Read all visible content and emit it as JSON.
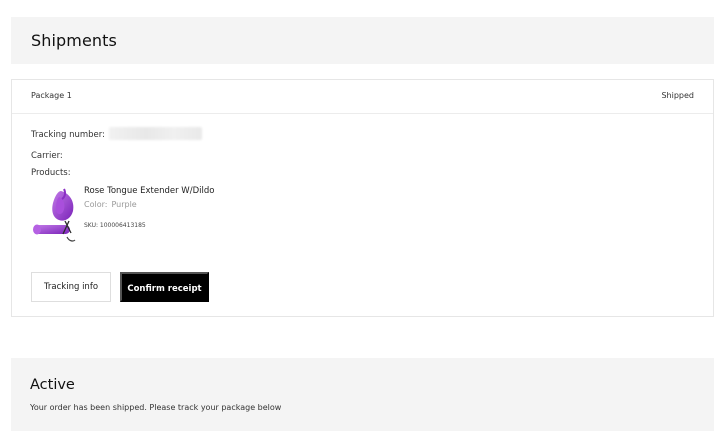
{
  "shipments": {
    "title": "Shipments"
  },
  "package": {
    "label": "Package 1",
    "status": "Shipped",
    "tracking_label": "Tracking number:",
    "carrier_label": "Carrier:",
    "products_label": "Products:",
    "product": {
      "name": "Rose Tongue  Extender W/Dildo",
      "color_label": "Color:",
      "color_value": "Purple",
      "sku": "SKU: 100006413185",
      "image_icon": "product-photo-purple-rose-toy"
    },
    "buttons": {
      "tracking_info": "Tracking info",
      "confirm_receipt": "Confirm receipt"
    }
  },
  "active": {
    "title": "Active",
    "description": "Your order has been shipped.  Please track your package below"
  },
  "colors": {
    "panel_bg": "#f4f4f4",
    "primary_button": "#000000",
    "product_purple": "#9b3fd4"
  }
}
